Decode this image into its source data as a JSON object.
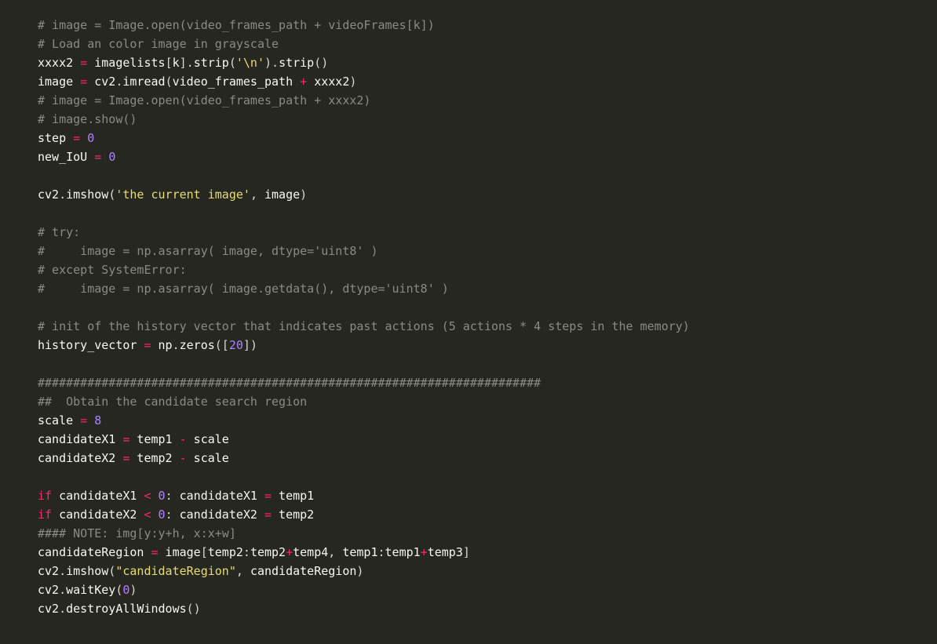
{
  "code": {
    "tokens": [
      [
        [
          "cm",
          "# image = Image.open(video_frames_path + videoFrames[k])"
        ]
      ],
      [
        [
          "cm",
          "# Load an color image in grayscale"
        ]
      ],
      [
        [
          "id",
          "xxxx2 "
        ],
        [
          "op",
          "="
        ],
        [
          "id",
          " imagelists"
        ],
        [
          "pn",
          "["
        ],
        [
          "id",
          "k"
        ],
        [
          "pn",
          "]."
        ],
        [
          "id",
          "strip"
        ],
        [
          "pn",
          "("
        ],
        [
          "st",
          "'\\n'"
        ],
        [
          "pn",
          ")."
        ],
        [
          "id",
          "strip"
        ],
        [
          "pn",
          "()"
        ]
      ],
      [
        [
          "id",
          "image "
        ],
        [
          "op",
          "="
        ],
        [
          "id",
          " cv2"
        ],
        [
          "pn",
          "."
        ],
        [
          "id",
          "imread"
        ],
        [
          "pn",
          "("
        ],
        [
          "id",
          "video_frames_path "
        ],
        [
          "op",
          "+"
        ],
        [
          "id",
          " xxxx2"
        ],
        [
          "pn",
          ")"
        ]
      ],
      [
        [
          "cm",
          "# image = Image.open(video_frames_path + xxxx2)"
        ]
      ],
      [
        [
          "cm",
          "# image.show()"
        ]
      ],
      [
        [
          "id",
          "step "
        ],
        [
          "op",
          "="
        ],
        [
          "id",
          " "
        ],
        [
          "nm",
          "0"
        ]
      ],
      [
        [
          "id",
          "new_IoU "
        ],
        [
          "op",
          "="
        ],
        [
          "id",
          " "
        ],
        [
          "nm",
          "0"
        ]
      ],
      [
        [
          "id",
          ""
        ]
      ],
      [
        [
          "id",
          "cv2"
        ],
        [
          "pn",
          "."
        ],
        [
          "id",
          "imshow"
        ],
        [
          "pn",
          "("
        ],
        [
          "st",
          "'the current image'"
        ],
        [
          "pn",
          ", "
        ],
        [
          "id",
          "image"
        ],
        [
          "pn",
          ")"
        ]
      ],
      [
        [
          "id",
          ""
        ]
      ],
      [
        [
          "cm",
          "# try:"
        ]
      ],
      [
        [
          "cm",
          "#     image = np.asarray( image, dtype='uint8' )"
        ]
      ],
      [
        [
          "cm",
          "# except SystemError:"
        ]
      ],
      [
        [
          "cm",
          "#     image = np.asarray( image.getdata(), dtype='uint8' )"
        ]
      ],
      [
        [
          "id",
          ""
        ]
      ],
      [
        [
          "cm",
          "# init of the history vector that indicates past actions (5 actions * 4 steps in the memory)"
        ]
      ],
      [
        [
          "id",
          "history_vector "
        ],
        [
          "op",
          "="
        ],
        [
          "id",
          " np"
        ],
        [
          "pn",
          "."
        ],
        [
          "id",
          "zeros"
        ],
        [
          "pn",
          "(["
        ],
        [
          "nm",
          "20"
        ],
        [
          "pn",
          "])"
        ]
      ],
      [
        [
          "id",
          ""
        ]
      ],
      [
        [
          "cm",
          "#######################################################################"
        ]
      ],
      [
        [
          "cm",
          "##  Obtain the candidate search region"
        ]
      ],
      [
        [
          "id",
          "scale "
        ],
        [
          "op",
          "="
        ],
        [
          "id",
          " "
        ],
        [
          "nm",
          "8"
        ]
      ],
      [
        [
          "id",
          "candidateX1 "
        ],
        [
          "op",
          "="
        ],
        [
          "id",
          " temp1 "
        ],
        [
          "op",
          "-"
        ],
        [
          "id",
          " scale"
        ]
      ],
      [
        [
          "id",
          "candidateX2 "
        ],
        [
          "op",
          "="
        ],
        [
          "id",
          " temp2 "
        ],
        [
          "op",
          "-"
        ],
        [
          "id",
          " scale"
        ]
      ],
      [
        [
          "id",
          ""
        ]
      ],
      [
        [
          "kw",
          "if"
        ],
        [
          "id",
          " candidateX1 "
        ],
        [
          "op",
          "<"
        ],
        [
          "id",
          " "
        ],
        [
          "nm",
          "0"
        ],
        [
          "pn",
          ": "
        ],
        [
          "id",
          "candidateX1 "
        ],
        [
          "op",
          "="
        ],
        [
          "id",
          " temp1"
        ]
      ],
      [
        [
          "kw",
          "if"
        ],
        [
          "id",
          " candidateX2 "
        ],
        [
          "op",
          "<"
        ],
        [
          "id",
          " "
        ],
        [
          "nm",
          "0"
        ],
        [
          "pn",
          ": "
        ],
        [
          "id",
          "candidateX2 "
        ],
        [
          "op",
          "="
        ],
        [
          "id",
          " temp2"
        ]
      ],
      [
        [
          "cm",
          "#### NOTE: img[y:y+h, x:x+w]"
        ]
      ],
      [
        [
          "id",
          "candidateRegion "
        ],
        [
          "op",
          "="
        ],
        [
          "id",
          " image"
        ],
        [
          "pn",
          "["
        ],
        [
          "id",
          "temp2"
        ],
        [
          "pn",
          ":"
        ],
        [
          "id",
          "temp2"
        ],
        [
          "op",
          "+"
        ],
        [
          "id",
          "temp4"
        ],
        [
          "pn",
          ", "
        ],
        [
          "id",
          "temp1"
        ],
        [
          "pn",
          ":"
        ],
        [
          "id",
          "temp1"
        ],
        [
          "op",
          "+"
        ],
        [
          "id",
          "temp3"
        ],
        [
          "pn",
          "]"
        ]
      ],
      [
        [
          "id",
          "cv2"
        ],
        [
          "pn",
          "."
        ],
        [
          "id",
          "imshow"
        ],
        [
          "pn",
          "("
        ],
        [
          "st",
          "\"candidateRegion\""
        ],
        [
          "pn",
          ", "
        ],
        [
          "id",
          "candidateRegion"
        ],
        [
          "pn",
          ")"
        ]
      ],
      [
        [
          "id",
          "cv2"
        ],
        [
          "pn",
          "."
        ],
        [
          "id",
          "waitKey"
        ],
        [
          "pn",
          "("
        ],
        [
          "nm",
          "0"
        ],
        [
          "pn",
          ")"
        ]
      ],
      [
        [
          "id",
          "cv2"
        ],
        [
          "pn",
          "."
        ],
        [
          "id",
          "destroyAllWindows"
        ],
        [
          "pn",
          "()"
        ]
      ]
    ]
  }
}
